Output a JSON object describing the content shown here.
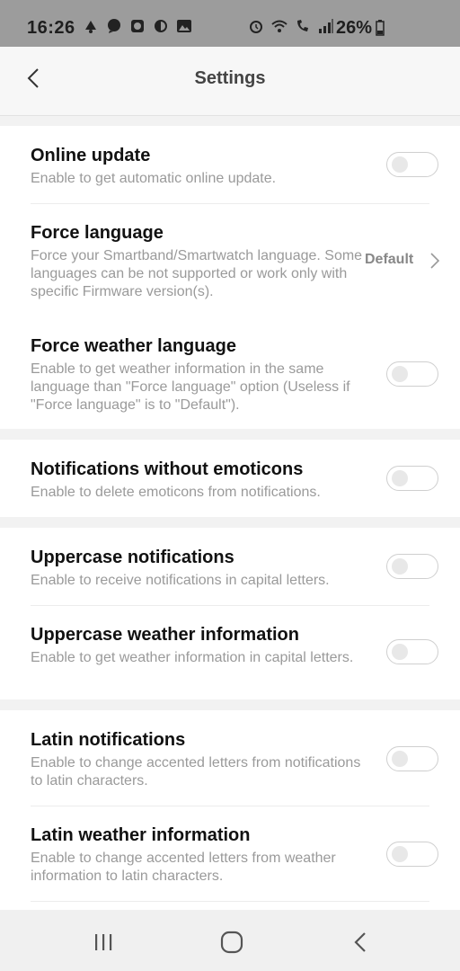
{
  "status_bar": {
    "time": "16:26",
    "battery": "26%",
    "left_icons": [
      "notification-icon",
      "chat-icon",
      "clock-app-icon",
      "shield-icon",
      "gallery-icon"
    ],
    "right_icons": [
      "alarm-icon",
      "wifi-icon",
      "call-signal-icon",
      "signal-icon",
      "battery-icon"
    ]
  },
  "header": {
    "title": "Settings"
  },
  "settings": [
    {
      "title": "Online update",
      "description": "Enable to get automatic online update.",
      "control": "toggle",
      "enabled": false
    },
    {
      "title": "Force language",
      "description": "Force your Smartband/Smartwatch language. Some languages can be not supported or work only with specific Firmware version(s).",
      "control": "select",
      "value": "Default"
    },
    {
      "title": "Force weather language",
      "description": "Enable to get weather information in the same language than \"Force language\" option (Useless if \"Force language\" is to \"Default\").",
      "control": "toggle",
      "enabled": false
    },
    {
      "title": "Notifications without emoticons",
      "description": "Enable to delete emoticons from notifications.",
      "control": "toggle",
      "enabled": false
    },
    {
      "title": "Uppercase notifications",
      "description": "Enable to receive notifications in capital letters.",
      "control": "toggle",
      "enabled": false
    },
    {
      "title": "Uppercase weather information",
      "description": "Enable to get weather information in capital letters.",
      "control": "toggle",
      "enabled": false
    },
    {
      "title": "Latin notifications",
      "description": "Enable to change accented letters from notifications to latin characters.",
      "control": "toggle",
      "enabled": false
    },
    {
      "title": "Latin weather information",
      "description": "Enable to change accented letters from weather information to latin characters.",
      "control": "toggle",
      "enabled": false
    }
  ],
  "nav_bar": {
    "buttons": [
      "recents-icon",
      "home-icon",
      "back-icon"
    ]
  }
}
